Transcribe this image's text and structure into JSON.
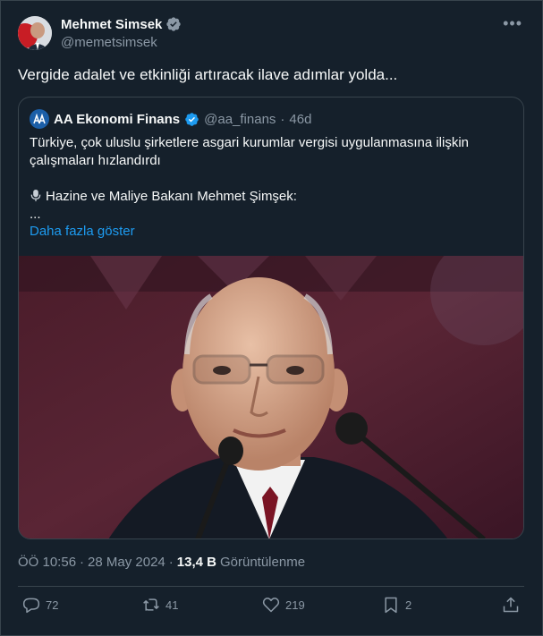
{
  "author": {
    "display_name": "Mehmet Simsek",
    "handle": "@memetsimsek",
    "verified_icon": "verified-badge-icon"
  },
  "tweet": {
    "text": "Vergide adalet ve etkinliği artıracak ilave adımlar yolda..."
  },
  "quote": {
    "author_name": "AA Ekonomi Finans",
    "author_handle": "@aa_finans",
    "separator": "·",
    "time": "46d",
    "lines": [
      "Türkiye, çok uluslu şirketlere asgari kurumlar vergisi uygulanmasına ilişkin",
      "çalışmaları hızlandırdı"
    ],
    "speaker_line": "Hazine ve Maliye Bakanı Mehmet Şimşek:",
    "ellipsis": "...",
    "show_more": "Daha fazla göster",
    "media_icon": "photo-portrait-at-microphones"
  },
  "meta": {
    "time": "ÖÖ 10:56",
    "separator": "·",
    "date": "28 May 2024",
    "separator2": "·",
    "views_count": "13,4 B",
    "views_label": "Görüntülenme"
  },
  "actions": {
    "replies": "72",
    "retweets": "41",
    "likes": "219",
    "bookmarks": "2"
  },
  "colors": {
    "background": "#15202b",
    "border": "#38444d",
    "text": "#f7f9f9",
    "secondary": "#8b98a5",
    "link": "#1d9bf0",
    "verified": "#1d9bf0"
  }
}
